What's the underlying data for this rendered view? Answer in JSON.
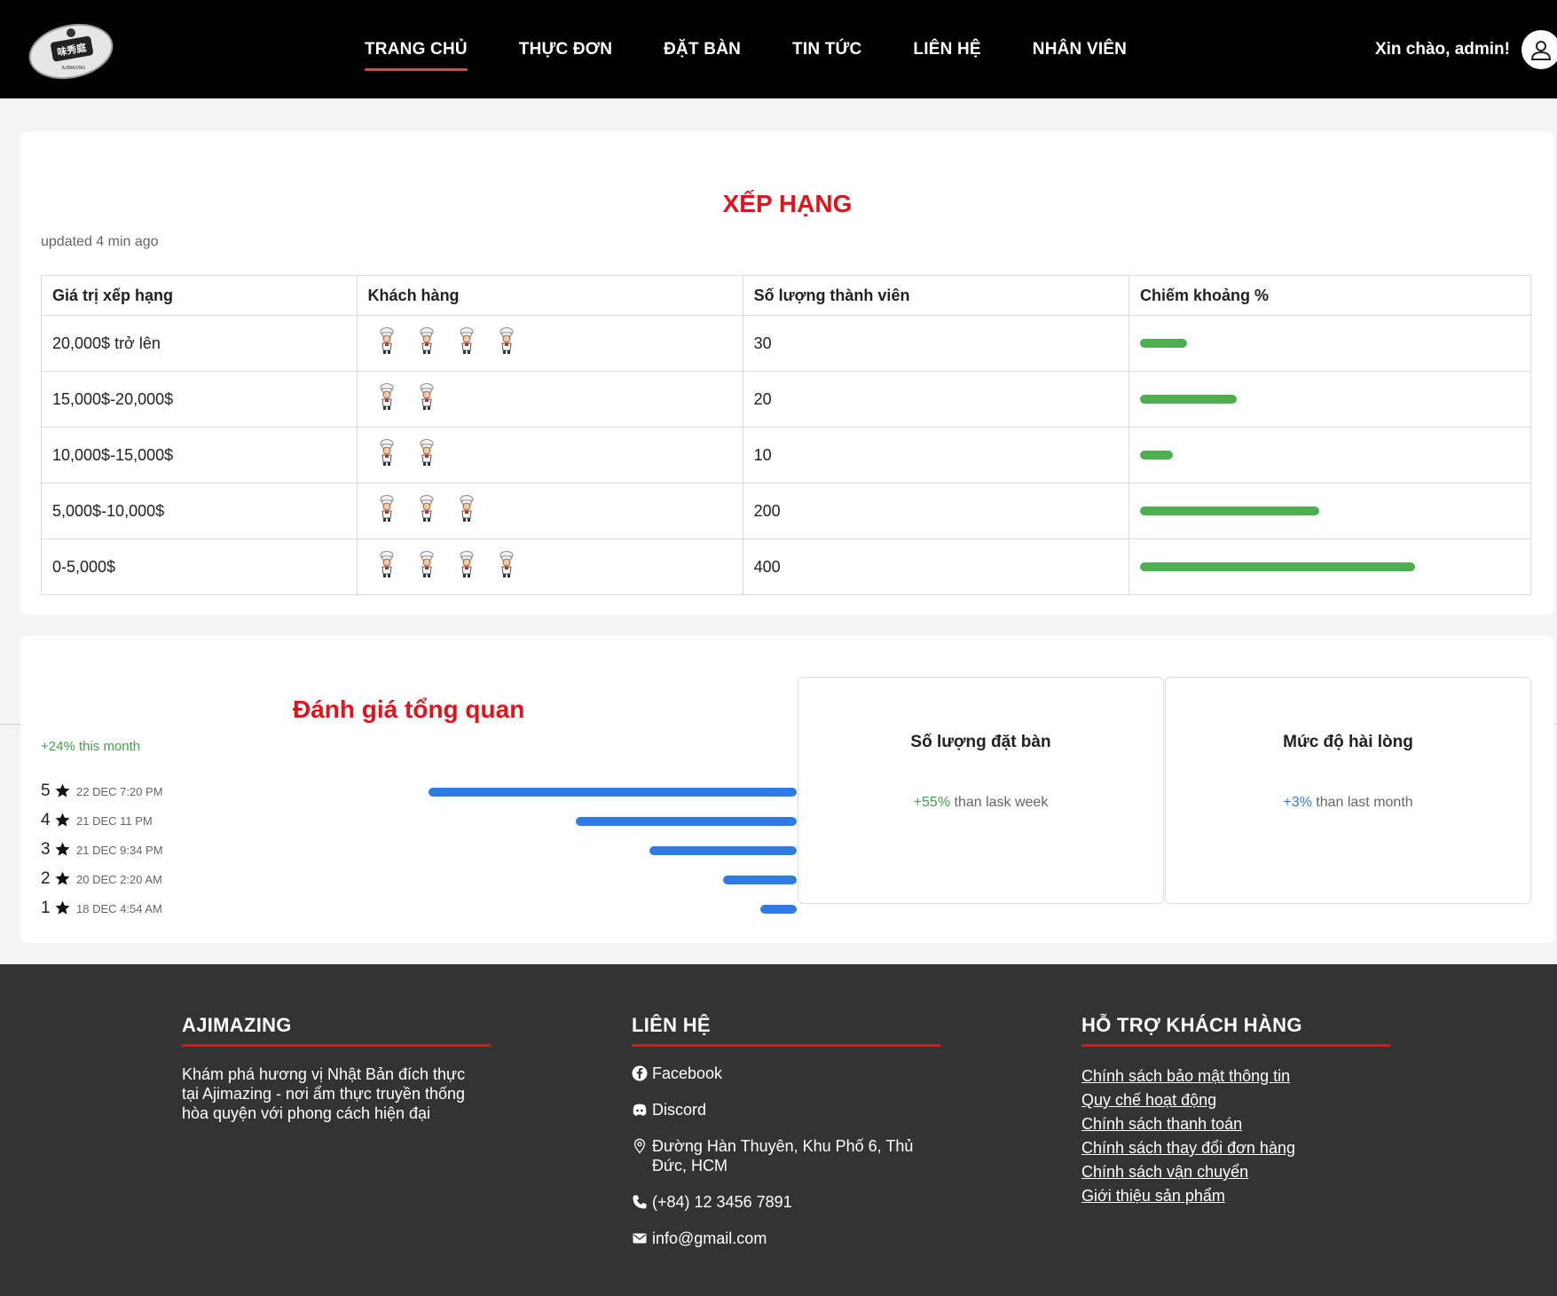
{
  "nav": {
    "logo_text": "AJIMAZING",
    "links": [
      "TRANG CHỦ",
      "THỰC ĐƠN",
      "ĐẶT BÀN",
      "TIN TỨC",
      "LIÊN HỆ",
      "NHÂN VIÊN"
    ],
    "active_index": 0,
    "greeting": "Xin chào, admin!",
    "avatar_icon": "user-icon"
  },
  "ranking": {
    "title": "XẾP HẠNG",
    "updated": "updated 4 min ago",
    "headers": [
      "Giá trị xếp hạng",
      "Khách hàng",
      "Số lượng thành viên",
      "Chiếm khoảng %"
    ],
    "rows": [
      {
        "range": "20,000$ trở lên",
        "chef_count": 4,
        "members": "30",
        "share": 0.17
      },
      {
        "range": "15,000$-20,000$",
        "chef_count": 2,
        "members": "20",
        "share": 0.35
      },
      {
        "range": "10,000$-15,000$",
        "chef_count": 2,
        "members": "10",
        "share": 0.12
      },
      {
        "range": "5,000$-10,000$",
        "chef_count": 3,
        "members": "200",
        "share": 0.65
      },
      {
        "range": "0-5,000$",
        "chef_count": 4,
        "members": "400",
        "share": 1.0
      }
    ],
    "bar_color": "#4caf50"
  },
  "overview": {
    "title": "Đánh giá tổng quan",
    "subtitle": "+24% this month",
    "ratings": [
      {
        "stars": "5",
        "date": "22 DEC 7:20 PM",
        "level": 1.0
      },
      {
        "stars": "4",
        "date": "21 DEC 11 PM",
        "level": 0.6
      },
      {
        "stars": "3",
        "date": "21 DEC 9:34 PM",
        "level": 0.4
      },
      {
        "stars": "2",
        "date": "20 DEC 2:20 AM",
        "level": 0.2
      },
      {
        "stars": "1",
        "date": "18 DEC 4:54 AM",
        "level": 0.1
      }
    ],
    "bar_color": "#2e7be6",
    "stats": [
      {
        "title": "Số lượng đặt bàn",
        "delta": "+55%",
        "rest": " than lask week",
        "delta_color": "#43a047"
      },
      {
        "title": "Mức độ hài lòng",
        "delta": "+3%",
        "rest": " than last month",
        "delta_color": "#2e7be6"
      }
    ]
  },
  "footer": {
    "brand": {
      "title": "AJIMAZING",
      "desc": "Khám phá hương vị Nhật Bản đích thực tại Ajimazing - nơi ẩm thực truyền thống hòa quyện với phong cách hiện đại"
    },
    "contact": {
      "title": "LIÊN HỆ",
      "facebook": "Facebook",
      "discord": "Discord",
      "address": "Đường Hàn Thuyên, Khu Phố 6, Thủ Đức, HCM",
      "phone": "(+84) 12 3456 7891",
      "email": "info@gmail.com"
    },
    "support": {
      "title": "HỖ TRỢ KHÁCH HÀNG",
      "links": [
        "Chính sách bảo mật thông tin",
        "Quy chế hoạt động",
        "Chính sách thanh toán",
        "Chính sách thay đổi đơn hàng",
        "Chính sách vận chuyển",
        "Giới thiệu sản phẩm"
      ]
    }
  }
}
